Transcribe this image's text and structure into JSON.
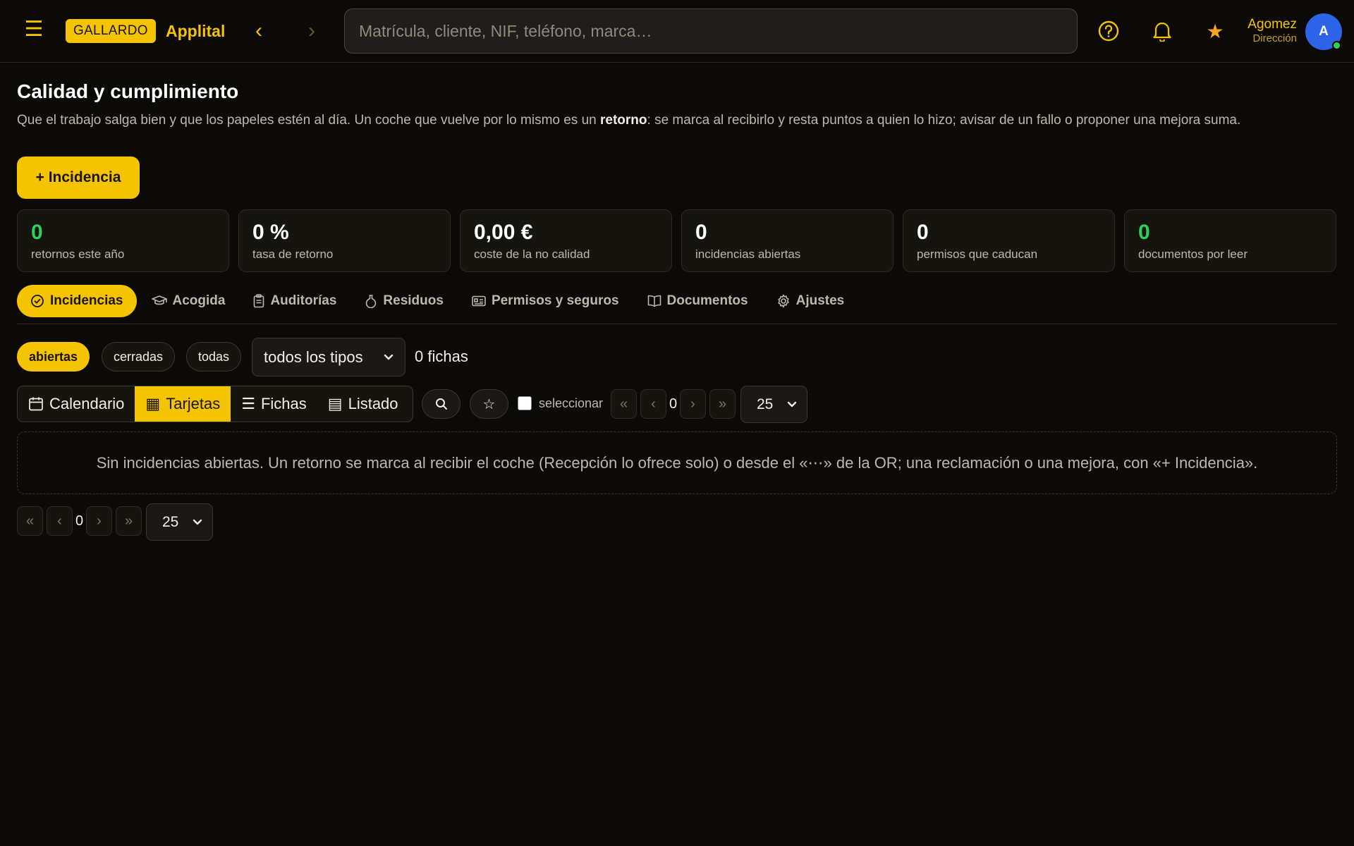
{
  "app": {
    "brand_badge": "GALLARDO",
    "brand_name": "Applital",
    "menu_icon": "hamburger-icon",
    "back_glyph": "‹",
    "forward_glyph": "›",
    "search_placeholder": "Matrícula, cliente, NIF, teléfono, marca…",
    "user_name": "Agomez",
    "user_role": "Dirección",
    "avatar_initial": "A",
    "accent_color": "#f5c400",
    "online_color": "#2fcf5a"
  },
  "page": {
    "title": "Calidad y cumplimiento",
    "description_before": "Que el trabajo salga bien y que los papeles estén al día. Un coche que vuelve por lo mismo es un ",
    "description_bold": "retorno",
    "description_after": ": se marca al recibirlo y resta puntos a quien lo hizo; avisar de un fallo o proponer una mejora suma.",
    "new_button": "+ Incidencia"
  },
  "stats": [
    {
      "value": "0",
      "label": "retornos este año"
    },
    {
      "value": "0 %",
      "label": "tasa de retorno"
    },
    {
      "value": "0,00 €",
      "label": "coste de la no calidad"
    },
    {
      "value": "0",
      "label": "incidencias abiertas"
    },
    {
      "value": "0",
      "label": "permisos que caducan"
    },
    {
      "value": "0",
      "label": "documentos por leer"
    }
  ],
  "tabs": [
    {
      "label": "Incidencias",
      "icon": "check-circle-icon"
    },
    {
      "label": "Acogida",
      "icon": "graduation-cap-icon"
    },
    {
      "label": "Auditorías",
      "icon": "clipboard-icon"
    },
    {
      "label": "Residuos",
      "icon": "flask-icon"
    },
    {
      "label": "Permisos y seguros",
      "icon": "id-card-icon"
    },
    {
      "label": "Documentos",
      "icon": "book-open-icon"
    },
    {
      "label": "Ajustes",
      "icon": "gear-icon"
    }
  ],
  "filters": {
    "chips": [
      "abiertas",
      "cerradas",
      "todas"
    ],
    "type_select": "todos los tipos",
    "count": "0 fichas"
  },
  "views": [
    {
      "label": "Calendario",
      "icon": "calendar-icon"
    },
    {
      "label": "Tarjetas",
      "icon": "grid-icon",
      "glyph": "▦"
    },
    {
      "label": "Fichas",
      "icon": "list-icon",
      "glyph": "☰"
    },
    {
      "label": "Listado",
      "icon": "table-icon",
      "glyph": "▤"
    }
  ],
  "toolbar": {
    "star_glyph": "☆",
    "select_label": "seleccionar",
    "first_glyph": "«",
    "prev_glyph": "‹",
    "next_glyph": "›",
    "last_glyph": "»",
    "page_number": "0",
    "page_size": "25"
  },
  "empty_message": "Sin incidencias abiertas. Un retorno se marca al recibir el coche (Recepción lo ofrece solo) o desde el «⋯» de la OR; una reclamación o una mejora, con «+ Incidencia»."
}
